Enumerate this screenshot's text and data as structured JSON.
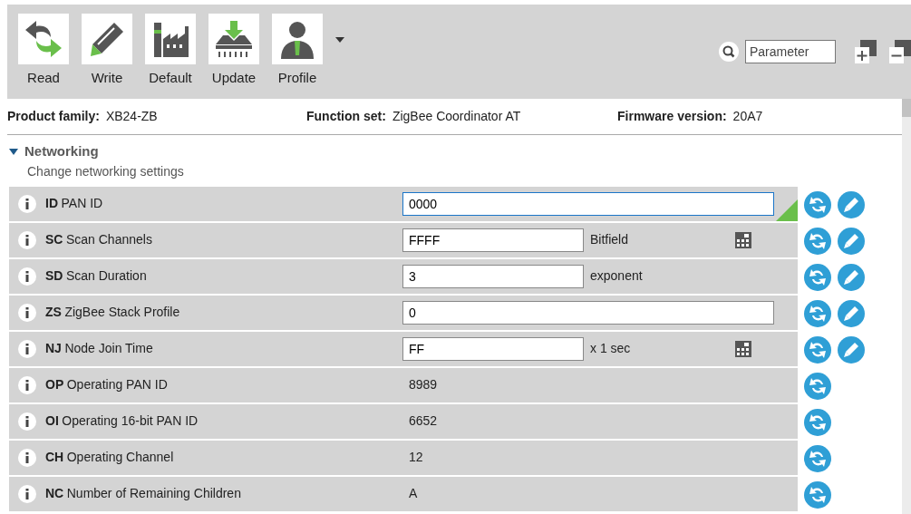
{
  "toolbar": {
    "buttons": [
      {
        "label": "Read",
        "kind": "read"
      },
      {
        "label": "Write",
        "kind": "write"
      },
      {
        "label": "Default",
        "kind": "default"
      },
      {
        "label": "Update",
        "kind": "update"
      },
      {
        "label": "Profile",
        "kind": "profile"
      }
    ],
    "search": {
      "value": "Parameter"
    }
  },
  "info": [
    {
      "label": "Product family:",
      "value": "XB24-ZB"
    },
    {
      "label": "Function set:",
      "value": "ZigBee Coordinator AT"
    },
    {
      "label": "Firmware version:",
      "value": "20A7"
    }
  ],
  "section": {
    "title": "Networking",
    "subtitle": "Change networking settings",
    "expanded": true,
    "rows": [
      {
        "kind": "editable",
        "code": "ID",
        "name": "PAN ID",
        "value": "0000",
        "unit": "",
        "calculator": false,
        "modified": true,
        "focused": true
      },
      {
        "kind": "editable",
        "code": "SC",
        "name": "Scan Channels",
        "value": "FFFF",
        "unit": "Bitfield",
        "calculator": true,
        "modified": false,
        "focused": false
      },
      {
        "kind": "editable",
        "code": "SD",
        "name": "Scan Duration",
        "value": "3",
        "unit": "exponent",
        "calculator": false,
        "modified": false,
        "focused": false
      },
      {
        "kind": "editable",
        "code": "ZS",
        "name": "ZigBee Stack Profile",
        "value": "0",
        "unit": "",
        "calculator": false,
        "modified": false,
        "focused": false
      },
      {
        "kind": "editable",
        "code": "NJ",
        "name": "Node Join Time",
        "value": "FF",
        "unit": "x 1 sec",
        "calculator": true,
        "modified": false,
        "focused": false
      },
      {
        "kind": "readonly",
        "code": "OP",
        "name": "Operating PAN ID",
        "value": "8989"
      },
      {
        "kind": "readonly",
        "code": "OI",
        "name": "Operating 16-bit PAN ID",
        "value": "6652"
      },
      {
        "kind": "readonly",
        "code": "CH",
        "name": "Operating Channel",
        "value": "12"
      },
      {
        "kind": "readonly",
        "code": "NC",
        "name": "Number of Remaining Children",
        "value": "A"
      }
    ]
  }
}
